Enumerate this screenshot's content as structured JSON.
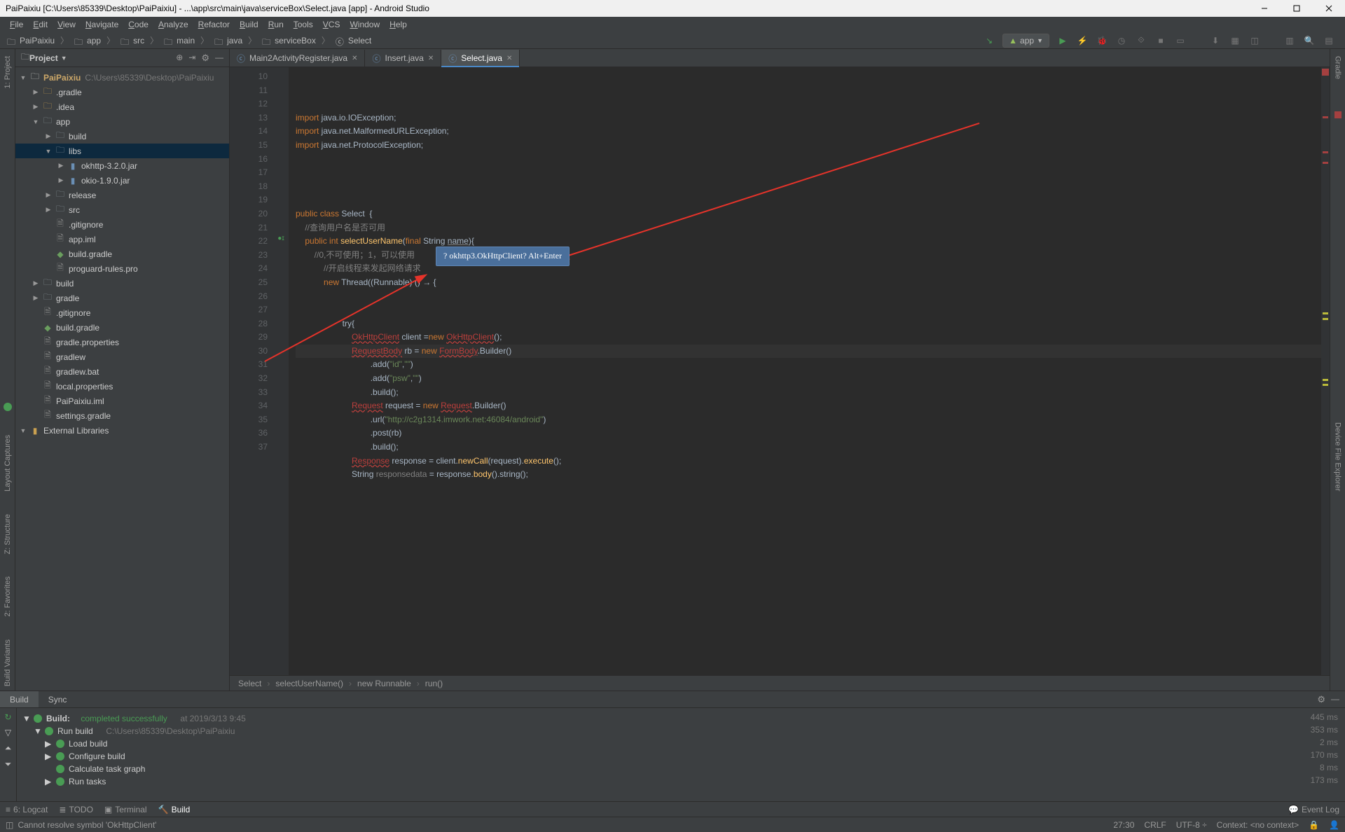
{
  "titlebar": {
    "text": "PaiPaixiu [C:\\Users\\85339\\Desktop\\PaiPaixiu] - ...\\app\\src\\main\\java\\serviceBox\\Select.java [app] - Android Studio"
  },
  "menubar": [
    "File",
    "Edit",
    "View",
    "Navigate",
    "Code",
    "Analyze",
    "Refactor",
    "Build",
    "Run",
    "Tools",
    "VCS",
    "Window",
    "Help"
  ],
  "navbar": {
    "path": [
      "PaiPaixiu",
      "app",
      "src",
      "main",
      "java",
      "serviceBox",
      "Select"
    ],
    "run_config": "app"
  },
  "sidebar": {
    "header": "Project",
    "root": {
      "name": "PaiPaixiu",
      "path": "C:\\Users\\85339\\Desktop\\PaiPaixiu"
    },
    "items": [
      {
        "depth": 1,
        "arrow": "▶",
        "icon": "folder",
        "label": ".gradle"
      },
      {
        "depth": 1,
        "arrow": "▶",
        "icon": "folder",
        "label": ".idea"
      },
      {
        "depth": 1,
        "arrow": "▼",
        "icon": "module",
        "label": "app"
      },
      {
        "depth": 2,
        "arrow": "▶",
        "icon": "folder-g",
        "label": "build"
      },
      {
        "depth": 2,
        "arrow": "▼",
        "icon": "folder-g",
        "label": "libs",
        "selected": true
      },
      {
        "depth": 3,
        "arrow": "▶",
        "icon": "jar",
        "label": "okhttp-3.2.0.jar"
      },
      {
        "depth": 3,
        "arrow": "▶",
        "icon": "jar",
        "label": "okio-1.9.0.jar"
      },
      {
        "depth": 2,
        "arrow": "▶",
        "icon": "folder-g",
        "label": "release"
      },
      {
        "depth": 2,
        "arrow": "▶",
        "icon": "folder-g",
        "label": "src"
      },
      {
        "depth": 2,
        "arrow": "",
        "icon": "file",
        "label": ".gitignore"
      },
      {
        "depth": 2,
        "arrow": "",
        "icon": "file",
        "label": "app.iml"
      },
      {
        "depth": 2,
        "arrow": "",
        "icon": "gradle",
        "label": "build.gradle"
      },
      {
        "depth": 2,
        "arrow": "",
        "icon": "file",
        "label": "proguard-rules.pro"
      },
      {
        "depth": 1,
        "arrow": "▶",
        "icon": "folder-g",
        "label": "build"
      },
      {
        "depth": 1,
        "arrow": "▶",
        "icon": "folder-g",
        "label": "gradle"
      },
      {
        "depth": 1,
        "arrow": "",
        "icon": "file",
        "label": ".gitignore"
      },
      {
        "depth": 1,
        "arrow": "",
        "icon": "gradle",
        "label": "build.gradle"
      },
      {
        "depth": 1,
        "arrow": "",
        "icon": "file",
        "label": "gradle.properties"
      },
      {
        "depth": 1,
        "arrow": "",
        "icon": "file",
        "label": "gradlew"
      },
      {
        "depth": 1,
        "arrow": "",
        "icon": "file",
        "label": "gradlew.bat"
      },
      {
        "depth": 1,
        "arrow": "",
        "icon": "file",
        "label": "local.properties"
      },
      {
        "depth": 1,
        "arrow": "",
        "icon": "file",
        "label": "PaiPaixiu.iml"
      },
      {
        "depth": 1,
        "arrow": "",
        "icon": "file",
        "label": "settings.gradle"
      },
      {
        "depth": 0,
        "arrow": "▼",
        "icon": "lib",
        "label": "External Libraries"
      }
    ]
  },
  "tabs": [
    {
      "label": "Main2ActivityRegister.java",
      "active": false
    },
    {
      "label": "Insert.java",
      "active": false
    },
    {
      "label": "Select.java",
      "active": true
    }
  ],
  "editor": {
    "first_line_no": 10,
    "last_line_no": 37,
    "intention": "? okhttp3.OkHttpClient? Alt+Enter",
    "caret_line": 27,
    "breadcrumb": [
      "Select",
      "selectUserName()",
      "new Runnable",
      "run()"
    ]
  },
  "build": {
    "tabs": [
      "Build",
      "Sync"
    ],
    "root": {
      "label": "Build:",
      "status": "completed successfully",
      "time": "at 2019/3/13 9:45"
    },
    "run_build": {
      "label": "Run build",
      "path": "C:\\Users\\85339\\Desktop\\PaiPaixiu"
    },
    "steps": [
      "Load build",
      "Configure build",
      "Calculate task graph",
      "Run tasks"
    ],
    "times": [
      "445 ms",
      "353 ms",
      "2 ms",
      "170 ms",
      "8 ms",
      "173 ms"
    ]
  },
  "toolstrip": {
    "items": [
      "6: Logcat",
      "TODO",
      "Terminal",
      "Build"
    ],
    "right": "Event Log"
  },
  "statusbar": {
    "left": "Cannot resolve symbol 'OkHttpClient'",
    "right": [
      "27:30",
      "CRLF",
      "UTF-8",
      "Context: <no context>"
    ]
  },
  "left_gutter": [
    "1: Project",
    "Layout Captures",
    "Z: Structure",
    "2: Favorites",
    "Build Variants"
  ],
  "right_gutter": [
    "Gradle",
    "Device File Explorer"
  ]
}
